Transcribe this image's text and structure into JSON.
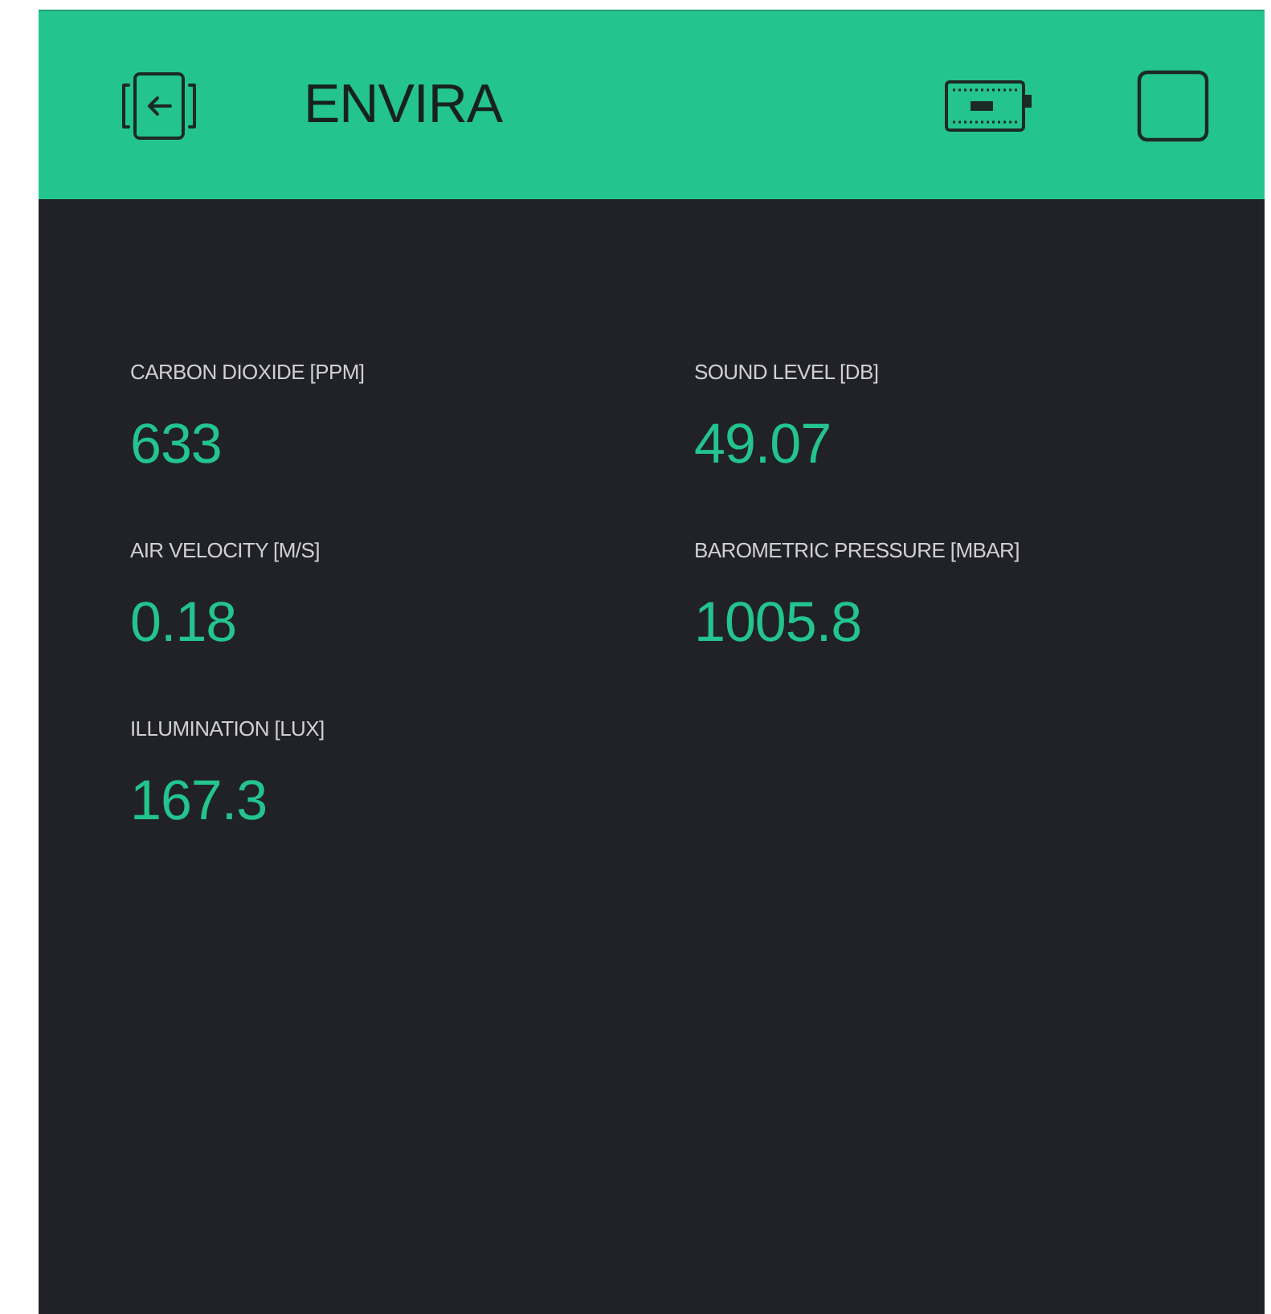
{
  "header": {
    "title": "ENVIRA"
  },
  "widgets": [
    {
      "label": "CARBON DIOXIDE [PPM]",
      "value": "633"
    },
    {
      "label": "SOUND LEVEL [DB]",
      "value": "49.07"
    },
    {
      "label": "AIR VELOCITY [M/S]",
      "value": "0.18"
    },
    {
      "label": "BAROMETRIC PRESSURE [MBAR]",
      "value": "1005.8"
    },
    {
      "label": "ILLUMINATION [LUX]",
      "value": "167.3"
    }
  ]
}
